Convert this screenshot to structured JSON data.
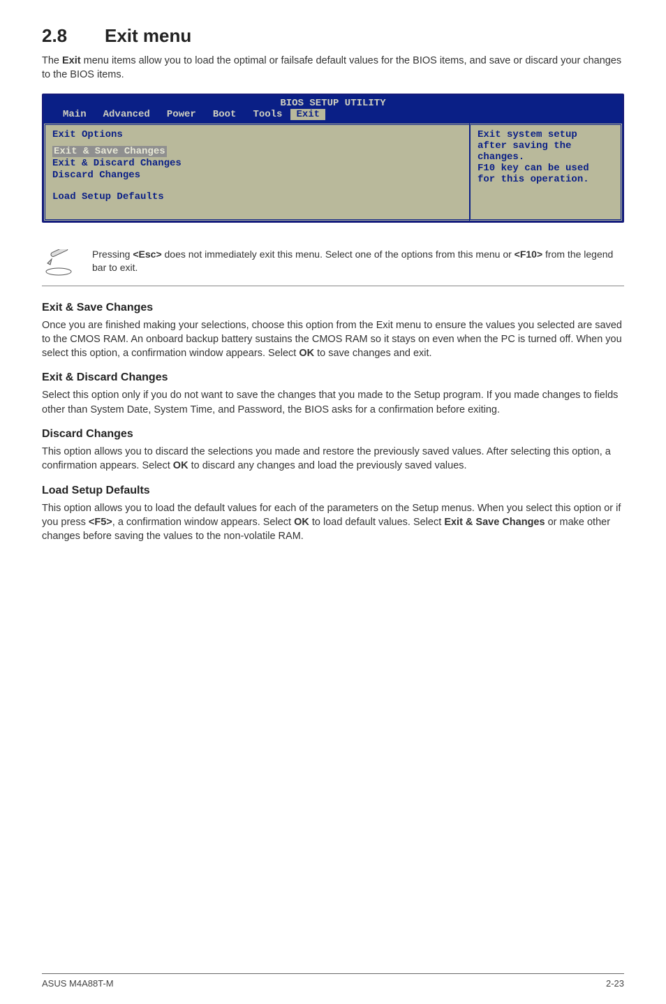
{
  "section": {
    "number": "2.8",
    "title": "Exit menu"
  },
  "intro": {
    "pre": "The ",
    "bold": "Exit",
    "post": " menu items allow you to load the optimal or failsafe default values for the BIOS items, and save or discard your changes to the BIOS items."
  },
  "bios": {
    "header_title": "BIOS SETUP UTILITY",
    "tabs": [
      "Main",
      "Advanced",
      "Power",
      "Boot",
      "Tools",
      "Exit"
    ],
    "active_tab": "Exit",
    "left": {
      "heading": "Exit Options",
      "items": [
        "Exit & Save Changes",
        "Exit & Discard Changes",
        "Discard Changes"
      ],
      "selected_index": 0,
      "items2": [
        "Load Setup Defaults"
      ]
    },
    "right": {
      "lines": [
        "Exit system setup",
        "after saving the",
        "changes.",
        "",
        "F10 key can be used",
        "for this operation."
      ]
    }
  },
  "note": {
    "pre1": "Pressing ",
    "b1": "<Esc>",
    "mid1": " does not immediately exit this menu. Select one of the options from this menu or ",
    "b2": "<F10>",
    "post1": " from the legend bar to exit."
  },
  "subsections": [
    {
      "title": "Exit & Save Changes",
      "body_pre": "Once you are finished making your selections, choose this option from the Exit menu to ensure the values you selected are saved to the CMOS RAM. An onboard backup battery sustains the CMOS RAM so it stays on even when the PC is turned off. When you select this option, a confirmation window appears. Select ",
      "body_bold": "OK",
      "body_post": " to save changes and exit."
    },
    {
      "title": "Exit & Discard Changes",
      "body_pre": "Select this option only if you do not want to save the changes that you made to the Setup program. If you made changes to fields other than System Date, System Time, and Password, the BIOS asks for a confirmation before exiting.",
      "body_bold": "",
      "body_post": ""
    },
    {
      "title": "Discard Changes",
      "body_pre": "This option allows you to discard the selections you made and restore the previously saved values. After selecting this option, a confirmation appears. Select ",
      "body_bold": "OK",
      "body_post": " to discard any changes and load the previously saved values."
    },
    {
      "title": "Load Setup Defaults",
      "body_pre": "This option allows you to load the default values for each of the parameters on the Setup menus. When you select this option or if you press ",
      "body_bold": "<F5>",
      "body_mid": ", a confirmation window appears. Select ",
      "body_bold2": "OK",
      "body_mid2": " to load default values. Select ",
      "body_bold3": "Exit & Save Changes",
      "body_post": " or make other changes before saving the values to the non-volatile RAM."
    }
  ],
  "footer": {
    "left": "ASUS M4A88T-M",
    "right": "2-23"
  }
}
